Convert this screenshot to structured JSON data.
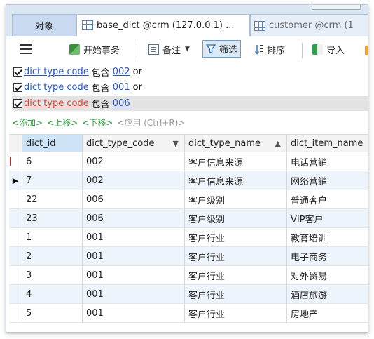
{
  "tabs": {
    "objects": "对象",
    "base_dict": "base_dict @crm (127.0.0.1) ...",
    "customer": "customer @crm (1"
  },
  "toolbar": {
    "begin_transaction": "开始事务",
    "note": "备注",
    "filter": "筛选",
    "sort": "排序",
    "import": "导入"
  },
  "filters": [
    {
      "field": "dict type code",
      "operator": "包含",
      "value": "002",
      "connector": "or",
      "checked": true,
      "active": false
    },
    {
      "field": "dict type code",
      "operator": "包含",
      "value": "001",
      "connector": "or",
      "checked": true,
      "active": false
    },
    {
      "field": "dict type code",
      "operator": "包含",
      "value": "006",
      "connector": "",
      "checked": true,
      "active": true
    }
  ],
  "filter_actions": {
    "add": "<添加>",
    "move_up": "<上移>",
    "move_down": "<下移>",
    "apply": "<应用 (Ctrl+R)>"
  },
  "grid": {
    "columns": [
      "dict_id",
      "dict_type_code",
      "dict_type_name",
      "dict_item_name"
    ],
    "rows": [
      [
        "6",
        "002",
        "客户信息来源",
        "电话营销"
      ],
      [
        "7",
        "002",
        "客户信息来源",
        "网络营销"
      ],
      [
        "22",
        "006",
        "客户级别",
        "普通客户"
      ],
      [
        "23",
        "006",
        "客户级别",
        "VIP客户"
      ],
      [
        "1",
        "001",
        "客户行业",
        "教育培训"
      ],
      [
        "2",
        "001",
        "客户行业",
        "电子商务"
      ],
      [
        "3",
        "001",
        "客户行业",
        "对外贸易"
      ],
      [
        "4",
        "001",
        "客户行业",
        "酒店旅游"
      ],
      [
        "5",
        "001",
        "客户行业",
        "房地产"
      ]
    ]
  },
  "colors": {
    "tab_bar": "#dbe6f3",
    "link": "#2a55c8",
    "active_link": "#e0413b",
    "action_green": "#2e9a3c",
    "selected_column_header": "#cfe3f7"
  }
}
